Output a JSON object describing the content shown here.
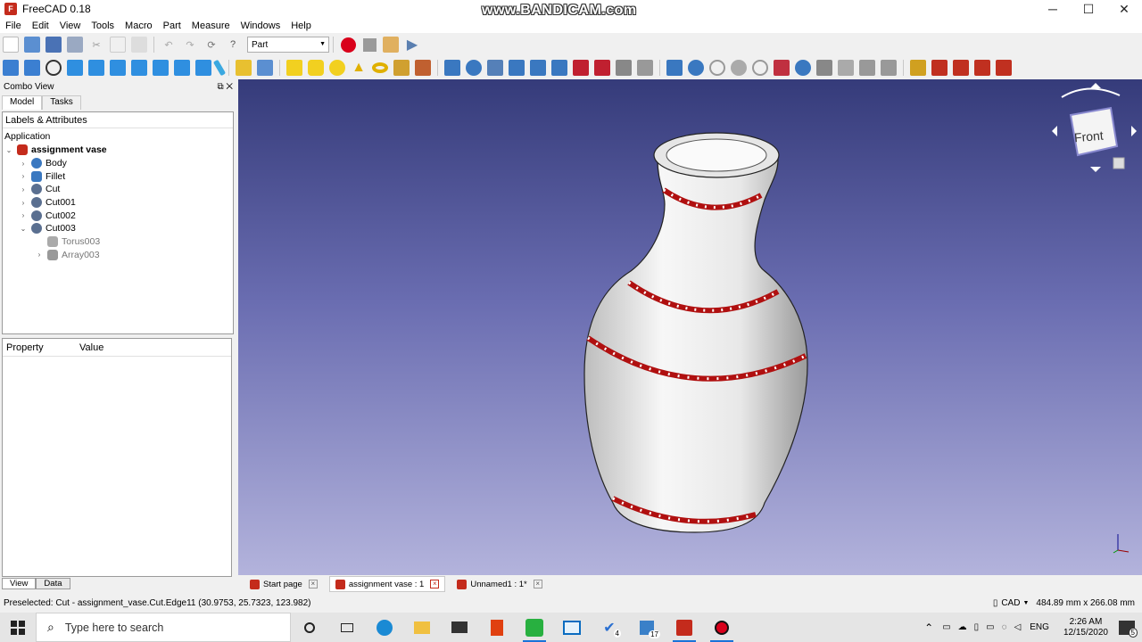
{
  "window": {
    "title": "FreeCAD 0.18",
    "watermark": "www.BANDICAM.com",
    "minimize": "─",
    "maximize": "☐",
    "close": "✕"
  },
  "menu": [
    "File",
    "Edit",
    "View",
    "Tools",
    "Macro",
    "Part",
    "Measure",
    "Windows",
    "Help"
  ],
  "workbench": "Part",
  "combo": {
    "title": "Combo View",
    "tabs": [
      "Model",
      "Tasks"
    ],
    "labels_header": "Labels & Attributes",
    "root": "Application",
    "document": "assignment vase",
    "items": [
      {
        "label": "Body",
        "expand": "›"
      },
      {
        "label": "Fillet",
        "expand": "›"
      },
      {
        "label": "Cut",
        "expand": "›"
      },
      {
        "label": "Cut001",
        "expand": "›"
      },
      {
        "label": "Cut002",
        "expand": "›"
      },
      {
        "label": "Cut003",
        "expand": "⌄"
      }
    ],
    "children": [
      {
        "label": "Torus003",
        "expand": ""
      },
      {
        "label": "Array003",
        "expand": "›"
      }
    ],
    "prop_headers": [
      "Property",
      "Value"
    ],
    "view_tabs": [
      "View",
      "Data"
    ]
  },
  "navcube": {
    "face": "Front"
  },
  "doc_tabs": [
    {
      "label": "Start page",
      "active": false
    },
    {
      "label": "assignment vase : 1",
      "active": true
    },
    {
      "label": "Unnamed1 : 1*",
      "active": false
    }
  ],
  "status": {
    "preselected": "Preselected: Cut - assignment_vase.Cut.Edge11 (30.9753, 25.7323, 123.982)",
    "nav_style": "CAD",
    "dimensions": "484.89 mm x 266.08 mm"
  },
  "taskbar": {
    "search_placeholder": "Type here to search",
    "language": "ENG",
    "time": "2:26 AM",
    "date": "12/15/2020",
    "notif_count": "5",
    "badge_todo": "4",
    "badge_cal": "17"
  },
  "colors": {
    "accent": "#1a73d9",
    "vase": "#f2f2f2",
    "band": "#b01010",
    "viewport_top": "#353b7a",
    "viewport_bottom": "#b3b3dc"
  }
}
